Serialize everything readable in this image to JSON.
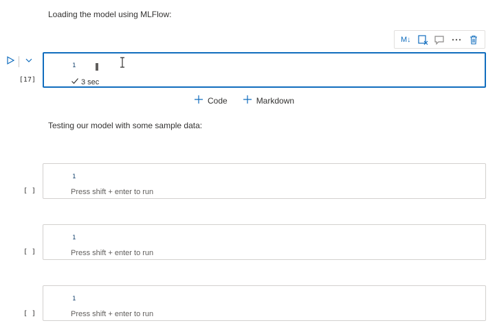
{
  "cells": {
    "md1": {
      "text": "Loading the model using MLFlow:"
    },
    "code1": {
      "count": "[17]",
      "line_no": "1",
      "status": "3 sec"
    },
    "md2": {
      "text": "Testing our model with some sample data:"
    },
    "code2": {
      "count": "[ ]",
      "line_no": "1",
      "hint": "Press shift + enter to run"
    },
    "code3": {
      "count": "[ ]",
      "line_no": "1",
      "hint": "Press shift + enter to run"
    },
    "code4": {
      "count": "[ ]",
      "line_no": "1",
      "hint": "Press shift + enter to run"
    }
  },
  "toolbar": {
    "markdown_label": "M↓",
    "icons": [
      "markdown-toggle-icon",
      "clear-output-icon",
      "comment-icon",
      "more-icon",
      "delete-icon"
    ]
  },
  "add_cell": {
    "code_label": "Code",
    "markdown_label": "Markdown"
  },
  "colors": {
    "accent": "#0f6cbd",
    "border": "#d2d0ce",
    "text": "#323130"
  }
}
